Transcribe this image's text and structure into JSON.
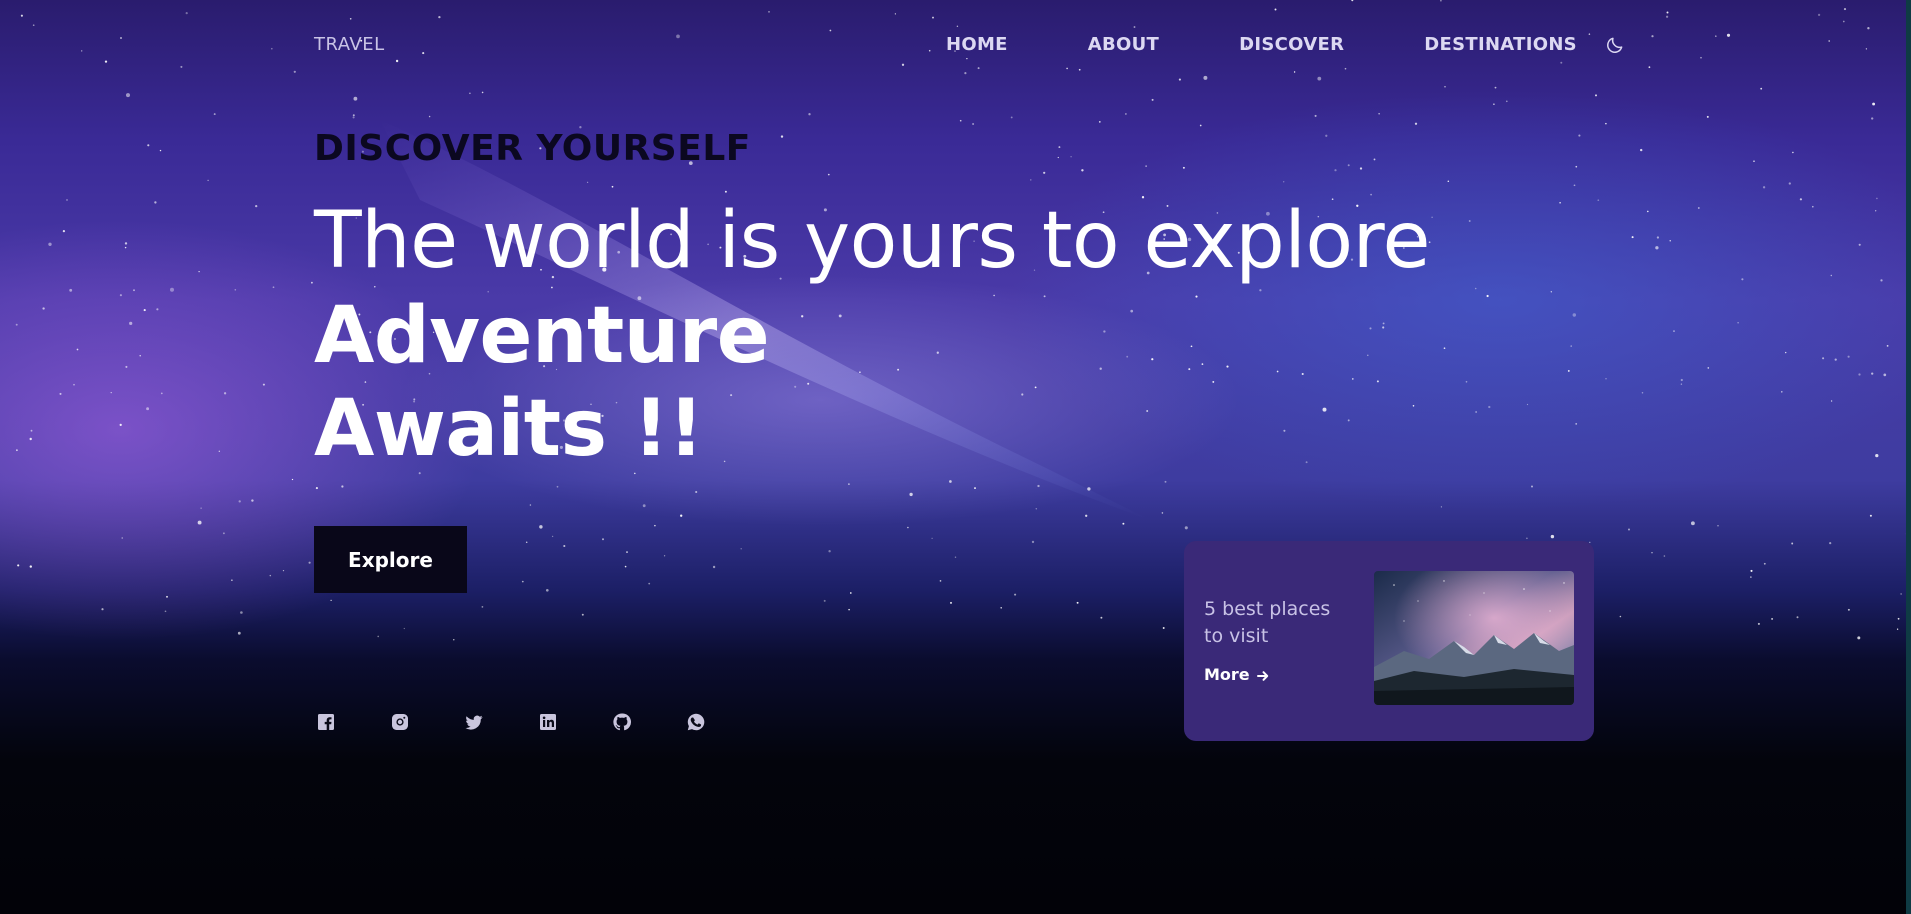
{
  "nav": {
    "brand": "TRAVEL",
    "items": [
      "HOME",
      "ABOUT",
      "DISCOVER",
      "DESTINATIONS"
    ],
    "theme_toggle_icon": "moon-icon"
  },
  "hero": {
    "eyebrow": "DISCOVER YOURSELF",
    "title_line1": "The world is yours to explore",
    "title_line2": "Adventure",
    "title_line3": "Awaits !!",
    "explore_label": "Explore"
  },
  "social": {
    "icons": [
      "facebook-icon",
      "instagram-icon",
      "twitter-icon",
      "linkedin-icon",
      "github-icon",
      "whatsapp-icon"
    ]
  },
  "card": {
    "title": "5 best places to visit",
    "more_label": "More",
    "image": "mountains-under-milky-way",
    "background_color": "#3a2978"
  },
  "colors": {
    "button_bg": "#090719",
    "eyebrow_text": "#0b0820",
    "headline_text": "#ffffff"
  }
}
